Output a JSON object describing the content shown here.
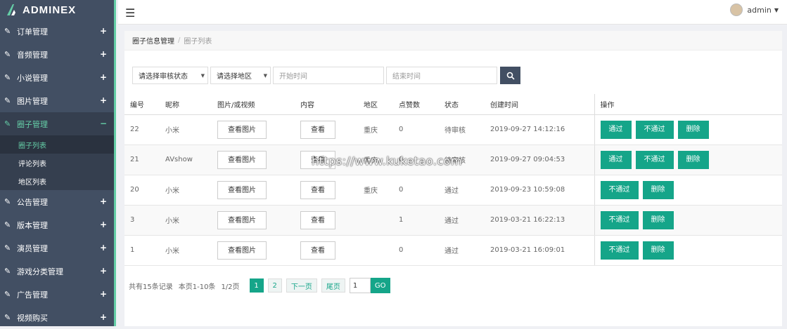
{
  "brand": {
    "name": "ADMINEX"
  },
  "sidebar": {
    "items": [
      {
        "label": "订单管理",
        "icon": "edit-icon"
      },
      {
        "label": "音频管理",
        "icon": "edit-icon"
      },
      {
        "label": "小说管理",
        "icon": "edit-icon"
      },
      {
        "label": "图片管理",
        "icon": "edit-icon"
      },
      {
        "label": "圈子管理",
        "icon": "edit-icon",
        "expanded": true
      },
      {
        "label": "公告管理",
        "icon": "edit-icon"
      },
      {
        "label": "版本管理",
        "icon": "edit-icon"
      },
      {
        "label": "演员管理",
        "icon": "edit-icon"
      },
      {
        "label": "游戏分类管理",
        "icon": "edit-icon"
      },
      {
        "label": "广告管理",
        "icon": "edit-icon"
      },
      {
        "label": "视频购买",
        "icon": "edit-icon"
      }
    ],
    "sub_items": [
      {
        "label": "圈子列表"
      },
      {
        "label": "评论列表"
      },
      {
        "label": "地区列表"
      }
    ],
    "expand_symbol": "+",
    "collapse_symbol": "−"
  },
  "topbar": {
    "user": "admin"
  },
  "breadcrumb": {
    "parent": "圈子信息管理",
    "current": "圈子列表"
  },
  "filters": {
    "status": "请选择审核状态",
    "region": "请选择地区",
    "start_placeholder": "开始时间",
    "end_placeholder": "结束时间"
  },
  "table": {
    "headers": [
      "编号",
      "昵称",
      "图片/或视频",
      "内容",
      "地区",
      "点赞数",
      "状态",
      "创建时间",
      "操作"
    ],
    "view_image": "查看图片",
    "view": "查看",
    "rows": [
      {
        "id": "22",
        "name": "小米",
        "region": "重庆",
        "likes": "0",
        "status": "待审核",
        "time": "2019-09-27 14:12:16",
        "actions": [
          "通过",
          "不通过",
          "删除"
        ]
      },
      {
        "id": "21",
        "name": "AVshow",
        "region": "重庆",
        "likes": "0",
        "status": "待审核",
        "time": "2019-09-27 09:04:53",
        "actions": [
          "通过",
          "不通过",
          "删除"
        ]
      },
      {
        "id": "20",
        "name": "小米",
        "region": "重庆",
        "likes": "0",
        "status": "通过",
        "time": "2019-09-23 10:59:08",
        "actions": [
          "不通过",
          "删除"
        ]
      },
      {
        "id": "3",
        "name": "小米",
        "region": "",
        "likes": "1",
        "status": "通过",
        "time": "2019-03-21 16:22:13",
        "actions": [
          "不通过",
          "删除"
        ]
      },
      {
        "id": "1",
        "name": "小米",
        "region": "",
        "likes": "0",
        "status": "通过",
        "time": "2019-03-21 16:09:01",
        "actions": [
          "不通过",
          "删除"
        ]
      }
    ]
  },
  "pager": {
    "total": "共有15条记录",
    "range": "本页1-10条",
    "pages": "1/2页",
    "p1": "1",
    "p2": "2",
    "next": "下一页",
    "last": "尾页",
    "input": "1",
    "go": "GO"
  },
  "watermark": "https://www.kuketao.com",
  "colors": {
    "accent": "#15a589",
    "sidebar": "#424f63"
  }
}
